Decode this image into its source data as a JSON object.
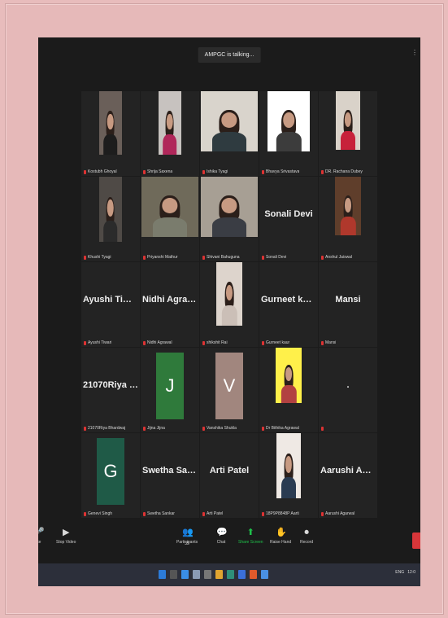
{
  "meeting": {
    "talking_indicator": "AMPGC is talking..."
  },
  "tiles": [
    {
      "label": "Kostubh Ghoyal",
      "kind": "video"
    },
    {
      "label": "Shrija Saxena",
      "kind": "video"
    },
    {
      "label": "Ishika Tyagi",
      "kind": "video"
    },
    {
      "label": "Bhavya Srivastava",
      "kind": "video"
    },
    {
      "label": "DR. Rachana Dubey",
      "kind": "video"
    },
    {
      "label": "Khushi Tyagi",
      "kind": "video"
    },
    {
      "label": "Priyanshi Mathur",
      "kind": "video"
    },
    {
      "label": "Shivani Bahuguna",
      "kind": "video"
    },
    {
      "label": "Sonali Devi",
      "display": "Sonali Devi",
      "kind": "name"
    },
    {
      "label": "Anshul Jaiswal",
      "kind": "video"
    },
    {
      "label": "Ayushi Tiwari",
      "display": "Ayushi Tiwari",
      "kind": "name"
    },
    {
      "label": "Nidhi Agrawal",
      "display": "Nidhi Agrawal",
      "kind": "name"
    },
    {
      "label": "shikshit Rai",
      "kind": "video"
    },
    {
      "label": "Gurneet kaur",
      "display": "Gurneet kaur",
      "kind": "name"
    },
    {
      "label": "Mansi",
      "display": "Mansi",
      "kind": "name"
    },
    {
      "label": "21070Riya Bhardwaj",
      "display": "21070Riya Bhar...",
      "kind": "name"
    },
    {
      "label": "Jijna Jijna",
      "letter": "J",
      "kind": "letter",
      "color": "#2f7a3b"
    },
    {
      "label": "Vanshika Shukla",
      "letter": "V",
      "kind": "letter",
      "color": "#a1867e"
    },
    {
      "label": "Dr Bithika Agrawal",
      "kind": "video"
    },
    {
      "label": "",
      "display": ".",
      "kind": "name"
    },
    {
      "label": "Genevi Singh",
      "letter": "G",
      "kind": "letter",
      "color": "#1f5a47"
    },
    {
      "label": "Swetha Sankar",
      "display": "Swetha Sankar",
      "kind": "name"
    },
    {
      "label": "Arti Patel",
      "display": "Arti Patel",
      "kind": "name"
    },
    {
      "label": "18P9P8848P Aarti",
      "kind": "video"
    },
    {
      "label": "Aarushi Agarwal",
      "display": "Aarushi Agarwal",
      "kind": "name"
    }
  ],
  "toolbar": {
    "mute_label": "ute",
    "stop_video_label": "Stop Video",
    "participants_label": "Participants",
    "participants_count": "35",
    "chat_label": "Chat",
    "share_label": "Share Screen",
    "raise_hand_label": "Raise Hand",
    "record_label": "Record"
  },
  "taskbar": {
    "lang": "ENG",
    "time": "12:0"
  }
}
